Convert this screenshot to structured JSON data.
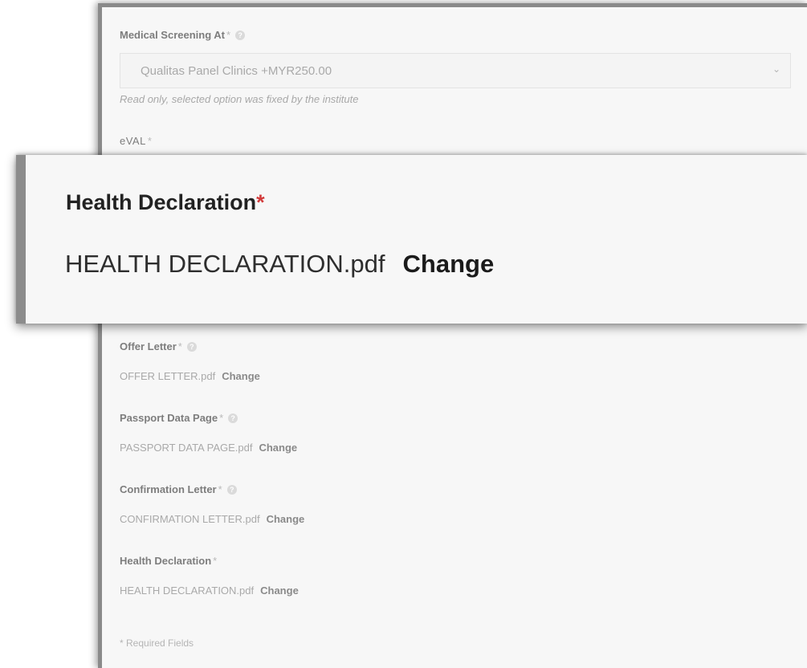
{
  "form": {
    "medical_screening": {
      "label": "Medical Screening At",
      "required_mark": "*",
      "help_icon": "question-circle-icon",
      "selected_value": "Qualitas Panel Clinics +MYR250.00",
      "hint": "Read only, selected option was fixed by the institute"
    },
    "eval": {
      "label": "eVAL",
      "required_mark": "*"
    },
    "files": [
      {
        "label": "Offer Letter",
        "required_mark": "*",
        "has_help": true,
        "filename": "OFFER LETTER.pdf",
        "action": "Change"
      },
      {
        "label": "Passport Data Page",
        "required_mark": "*",
        "has_help": true,
        "filename": "PASSPORT DATA PAGE.pdf",
        "action": "Change"
      },
      {
        "label": "Confirmation Letter",
        "required_mark": "*",
        "has_help": true,
        "filename": "CONFIRMATION LETTER.pdf",
        "action": "Change"
      },
      {
        "label": "Health Declaration",
        "required_mark": "*",
        "has_help": false,
        "filename": "HEALTH DECLARATION.pdf",
        "action": "Change"
      }
    ],
    "footnote": "* Required Fields"
  },
  "zoom_callout": {
    "title": "Health Declaration",
    "required_mark": "*",
    "filename": "HEALTH DECLARATION.pdf",
    "action": "Change"
  },
  "colors": {
    "required_star_zoom": "#d23a3a",
    "panel_background": "#f7f7f7"
  }
}
